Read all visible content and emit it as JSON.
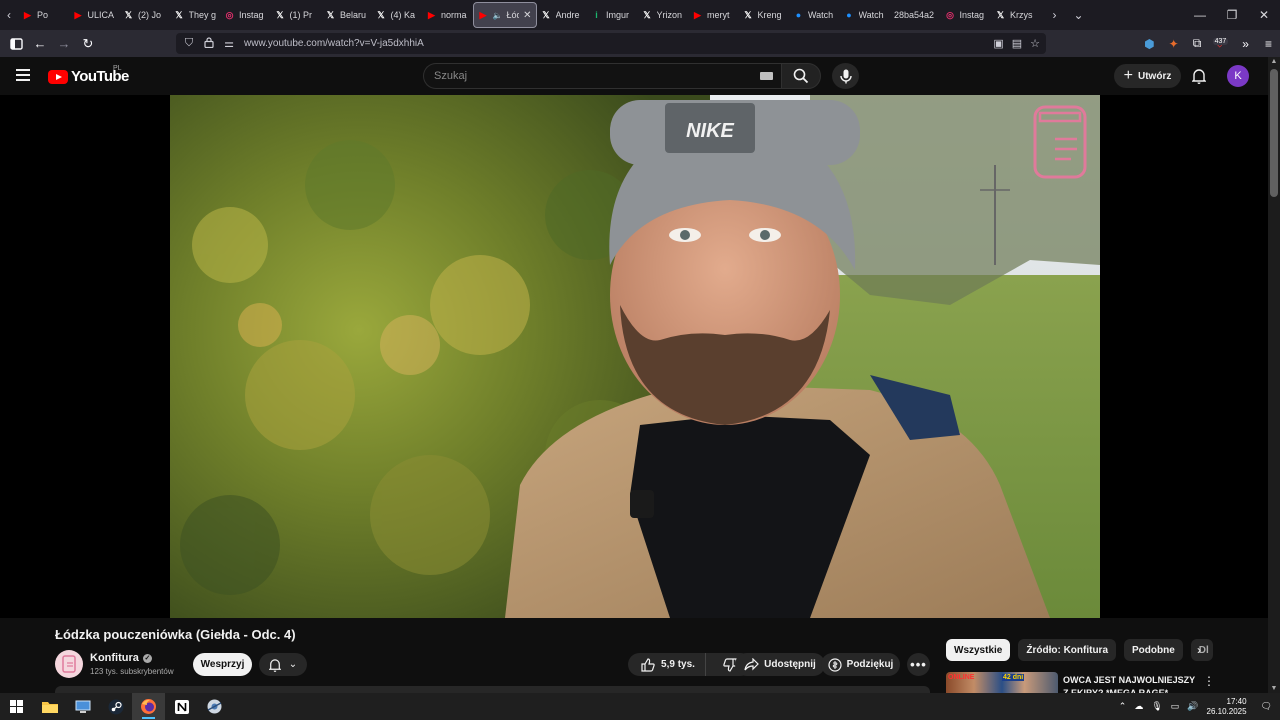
{
  "browser": {
    "tabs": [
      {
        "label": "Po",
        "icon": "youtube-icon",
        "color": "#ff0000"
      },
      {
        "label": "ULICA",
        "icon": "youtube-icon",
        "color": "#ff0000"
      },
      {
        "label": "(2) Jo",
        "icon": "x-icon",
        "color": "#ffffff"
      },
      {
        "label": "They g",
        "icon": "x-icon",
        "color": "#ffffff"
      },
      {
        "label": "Instag",
        "icon": "instagram-icon",
        "color": "#e1306c"
      },
      {
        "label": "(1) Pr",
        "icon": "x-icon",
        "color": "#ffffff"
      },
      {
        "label": "Belaru",
        "icon": "x-icon",
        "color": "#ffffff"
      },
      {
        "label": "(4) Ka",
        "icon": "x-icon",
        "color": "#ffffff"
      },
      {
        "label": "norma",
        "icon": "youtube-icon",
        "color": "#ff0000"
      },
      {
        "label": "Łódz",
        "icon": "youtube-icon",
        "color": "#ff0000",
        "active": true
      },
      {
        "label": "Andre",
        "icon": "x-icon",
        "color": "#ffffff"
      },
      {
        "label": "Imgur",
        "icon": "imgur-icon",
        "color": "#1bb76e"
      },
      {
        "label": "Yrizon",
        "icon": "x-icon",
        "color": "#ffffff"
      },
      {
        "label": "meryt",
        "icon": "youtube-icon",
        "color": "#ff0000"
      },
      {
        "label": "Kreng",
        "icon": "x-icon",
        "color": "#ffffff"
      },
      {
        "label": "Watch",
        "icon": "stream-icon",
        "color": "#1e90ff"
      },
      {
        "label": "Watch",
        "icon": "stream-icon",
        "color": "#1e90ff"
      },
      {
        "label": "28ba54a2",
        "icon": "",
        "color": "#ffffff"
      },
      {
        "label": "Instag",
        "icon": "instagram-icon",
        "color": "#e1306c"
      },
      {
        "label": "Krzys",
        "icon": "x-icon",
        "color": "#ffffff"
      }
    ],
    "url": "www.youtube.com/watch?v=V-ja5dxhhiA",
    "extension_badge": "437"
  },
  "youtube": {
    "logo_text": "YouTube",
    "country_code": "PL",
    "search_placeholder": "Szukaj",
    "create_label": "Utwórz",
    "avatar_letter": "K"
  },
  "video": {
    "title": "Łódzka pouczeniówka (Giełda - Odc. 4)",
    "channel_name": "Konfitura",
    "subscribers": "123 tys. subskrybentów",
    "join_label": "Wesprzyj",
    "likes": "5,9 tys.",
    "share_label": "Udostępnij",
    "thanks_label": "Podziękuj"
  },
  "sidebar": {
    "chips": [
      "Wszystkie",
      "Źródło: Konfitura",
      "Podobne",
      "Dl"
    ],
    "recommendation": {
      "title": "OWCA JEST NAJWOLNIEJSZY Z EKIPY? *MEGA RAGE*",
      "badge_a": "ONLINE",
      "badge_b": "42 dni"
    }
  },
  "taskbar": {
    "time": "17:40",
    "date": "26.10.2025"
  }
}
